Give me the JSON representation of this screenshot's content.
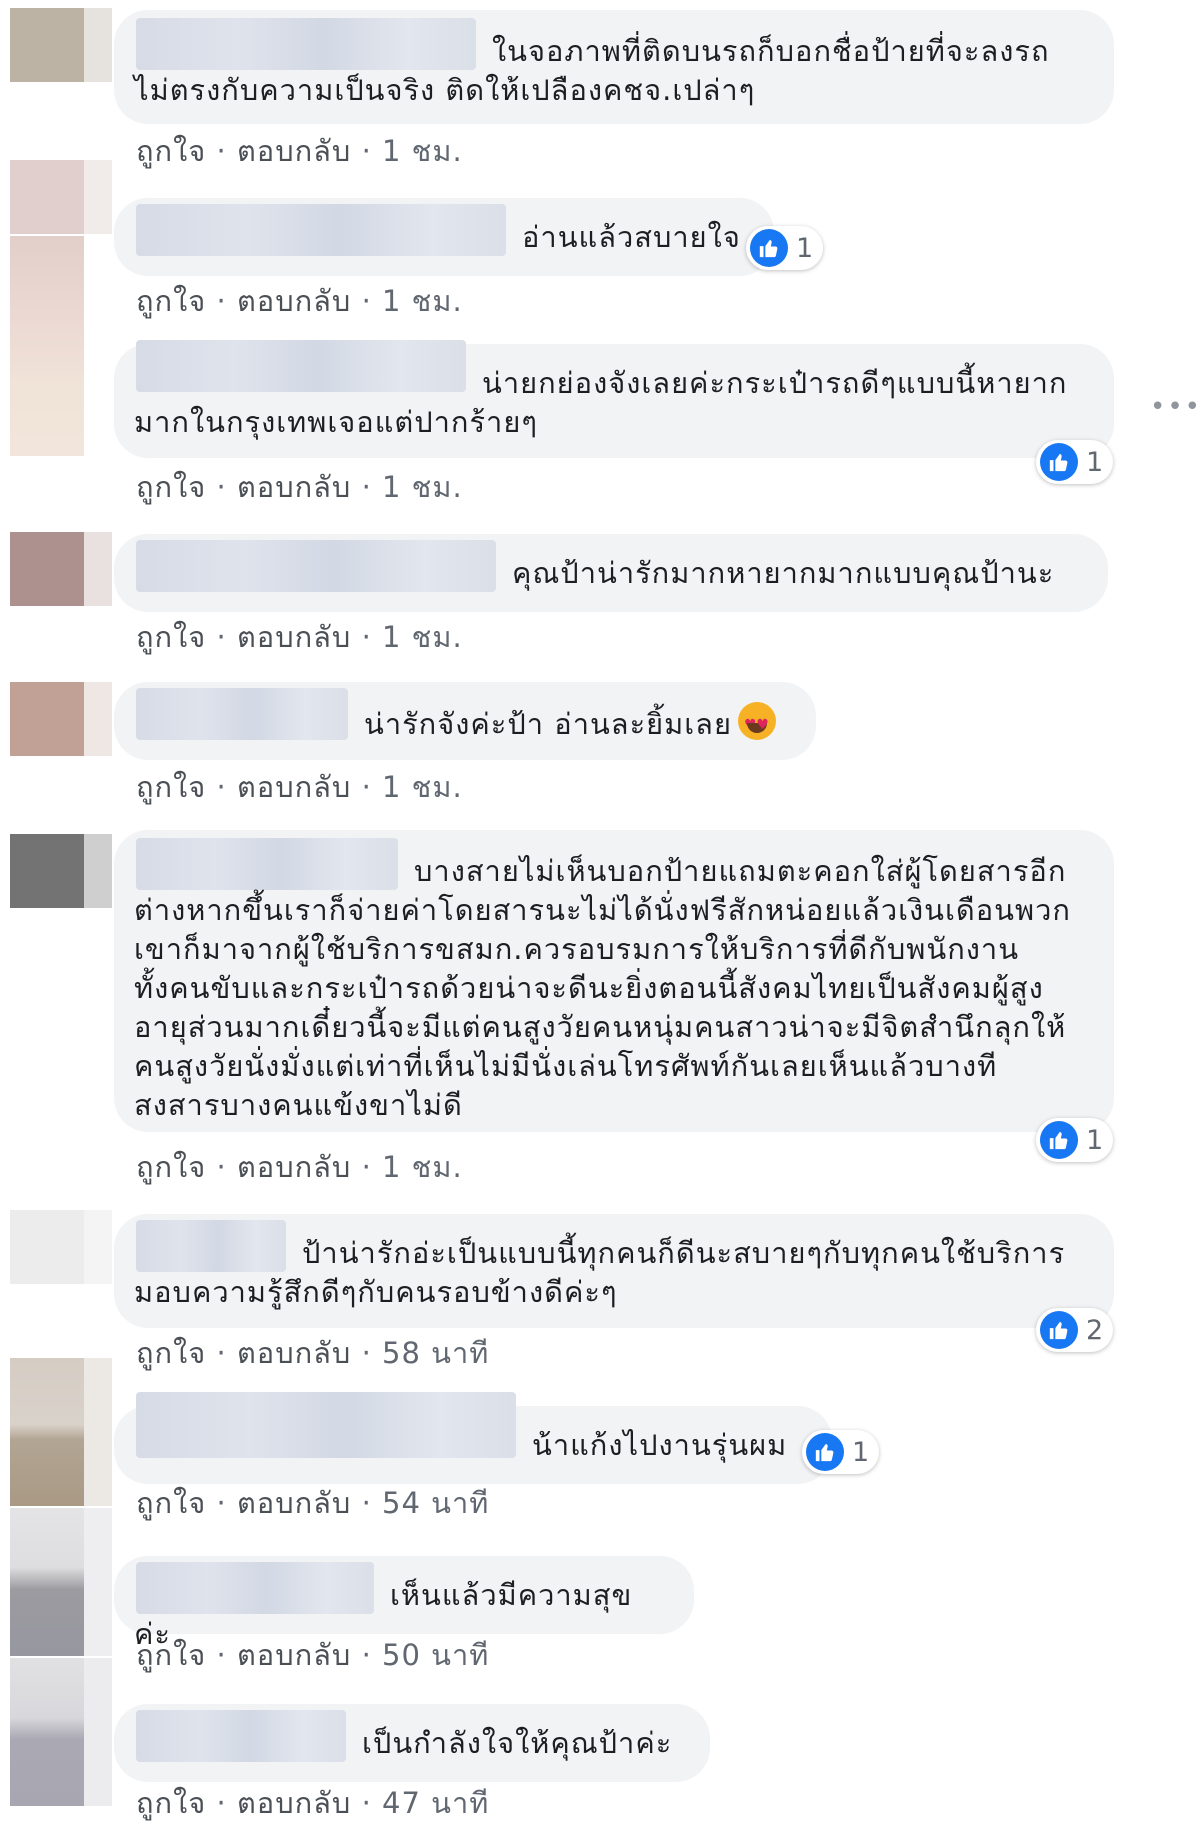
{
  "ui": {
    "like_label": "ถูกใจ",
    "reply_label": "ตอบกลับ",
    "separator": "·",
    "more_icon": "more-horizontal-icon",
    "like_icon": "thumbs-up-icon",
    "like_color": "#1877f2"
  },
  "comments": [
    {
      "text": "ในจอภาพที่ติดบนรถก็บอกชื่อป้ายที่จะลงรถไม่ตรงกับความเป็นจริง ติดให้เปลืองคชจ.เปล่าๆ",
      "time": "1 ชม."
    },
    {
      "text": "อ่านแล้วสบายใจ",
      "time": "1 ชม.",
      "likes": "1"
    },
    {
      "text": "น่ายกย่องจังเลยค่ะกระเป๋ารถดีๆแบบนี้หายากมากในกรุงเทพเจอแต่ปากร้ายๆ",
      "time": "1 ชม.",
      "likes": "1"
    },
    {
      "text": "คุณป้าน่ารักมากหายากมากแบบคุณป้านะ",
      "time": "1 ชม."
    },
    {
      "text": "น่ารักจังค่ะป้า อ่านละยิ้มเลย",
      "time": "1 ชม.",
      "emoji": "smiling-face-with-heart-eyes"
    },
    {
      "text": "บางสายไม่เห็นบอกป้ายแถมตะคอกใส่ผู้โดยสารอีกต่างหากขึ้นเราก็จ่ายค่าโดยสารนะไม่ได้นั่งฟรีสักหน่อยแล้วเงินเดือนพวกเขาก็มาจากผู้ใช้บริการขสมก.ควรอบรมการให้บริการที่ดีกับพนักงานทั้งคนขับและกระเป๋ารถด้วยน่าจะดีนะยิ่งตอนนี้สังคมไทยเป็นสังคมผู้สูงอายุส่วนมากเดี๋ยวนี้จะมีแต่คนสูงวัยคนหนุ่มคนสาวน่าจะมีจิตสำนึกลุกให้คนสูงวัยนั่งมั่งแต่เท่าที่เห็นไม่มีนั่งเล่นโทรศัพท์กันเลยเห็นแล้วบางทีสงสารบางคนแข้งขาไม่ดี",
      "time": "1 ชม.",
      "likes": "1"
    },
    {
      "text": "ป้าน่ารักอ่ะเป็นแบบนี้ทุกคนก็ดีนะสบายๆกับทุกคนใช้บริการมอบความรู้สึกดีๆกับคนรอบข้างดีค่ะๆ",
      "time": "58 นาที",
      "likes": "2"
    },
    {
      "text": "น้าแก้งไปงานรุ่นผม",
      "time": "54 นาที",
      "likes": "1"
    },
    {
      "text": "เห็นแล้วมีความสุขค่ะ",
      "time": "50 นาที"
    },
    {
      "text": "เป็นกำลังใจให้คุณป้าค่ะ",
      "time": "47 นาที"
    }
  ]
}
